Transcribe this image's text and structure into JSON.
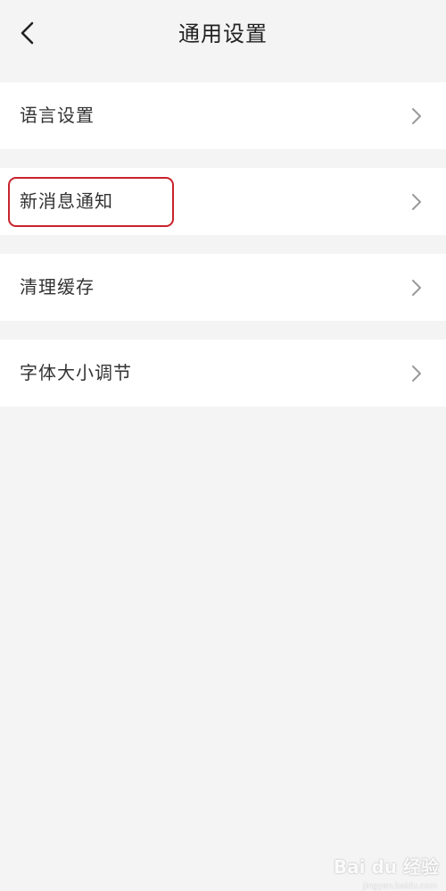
{
  "header": {
    "title": "通用设置",
    "back_icon": "chevron-left-icon"
  },
  "settings": {
    "items": [
      {
        "label": "语言设置",
        "icon": "chevron-right-icon"
      },
      {
        "label": "新消息通知",
        "icon": "chevron-right-icon"
      },
      {
        "label": "清理缓存",
        "icon": "chevron-right-icon"
      },
      {
        "label": "字体大小调节",
        "icon": "chevron-right-icon"
      }
    ]
  },
  "annotation": {
    "highlight_color": "#c8232c"
  },
  "watermark": {
    "brand": "Bai du 经验",
    "url": "jingyan.baidu.com"
  },
  "colors": {
    "background": "#f4f4f4",
    "row_background": "#ffffff",
    "text": "#333333",
    "chevron": "#9a9a9a"
  }
}
